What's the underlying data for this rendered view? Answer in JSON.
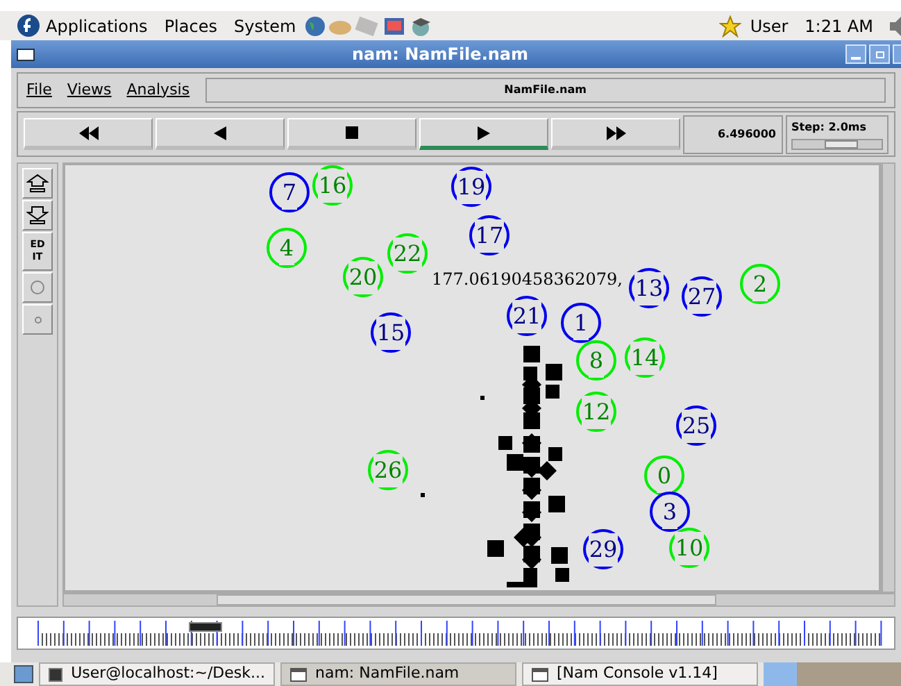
{
  "top_panel": {
    "menus": [
      "Applications",
      "Places",
      "System"
    ],
    "user": "User",
    "clock": "1:21 AM"
  },
  "window": {
    "title": "nam: NamFile.nam"
  },
  "menu": [
    "File",
    "Views",
    "Analysis"
  ],
  "file_label": "NamFile.nam",
  "controls": [
    {
      "kind": "rewind",
      "selected": false
    },
    {
      "kind": "back",
      "selected": false
    },
    {
      "kind": "stop",
      "selected": false
    },
    {
      "kind": "play",
      "selected": true
    },
    {
      "kind": "forward",
      "selected": false
    }
  ],
  "time": "6.496000",
  "step": {
    "label": "Step: 2.0ms",
    "level": 0.55
  },
  "tools": [
    {
      "kind": "zoom-in"
    },
    {
      "kind": "zoom-out"
    },
    {
      "kind": "edit",
      "label": "ED IT"
    },
    {
      "kind": "circle"
    },
    {
      "kind": "dot"
    }
  ],
  "nodes": [
    {
      "label": "7",
      "color": "#0000ee"
    },
    {
      "label": "16",
      "color": "#00ee00"
    },
    {
      "label": "19",
      "color": "#0000ee"
    },
    {
      "label": "4",
      "color": "#00ee00"
    },
    {
      "label": "22",
      "color": "#00ee00"
    },
    {
      "label": "20",
      "color": "#00ee00"
    },
    {
      "label": "17",
      "color": "#0000ee"
    },
    {
      "label": "13",
      "color": "#0000ee"
    },
    {
      "label": "27",
      "color": "#0000ee"
    },
    {
      "label": "2",
      "color": "#00ee00"
    },
    {
      "label": "21",
      "color": "#0000ee"
    },
    {
      "label": "1",
      "color": "#0000ee"
    },
    {
      "label": "15",
      "color": "#0000ee"
    },
    {
      "label": "8",
      "color": "#00ee00"
    },
    {
      "label": "14",
      "color": "#00ee00"
    },
    {
      "label": "12",
      "color": "#00ee00"
    },
    {
      "label": "25",
      "color": "#0000ee"
    },
    {
      "label": "26",
      "color": "#00ee00"
    },
    {
      "label": "0",
      "color": "#00ee00"
    },
    {
      "label": "3",
      "color": "#0000ee"
    },
    {
      "label": "29",
      "color": "#0000ee"
    },
    {
      "label": "10",
      "color": "#00ee00"
    }
  ],
  "annotation": "177.06190458362079,",
  "taskbar": [
    {
      "label": "User@localhost:~/Desk...",
      "kind": "terminal",
      "selected": false
    },
    {
      "label": "nam: NamFile.nam",
      "kind": "window",
      "selected": true
    },
    {
      "label": "[Nam Console v1.14]",
      "kind": "window",
      "selected": false
    }
  ]
}
